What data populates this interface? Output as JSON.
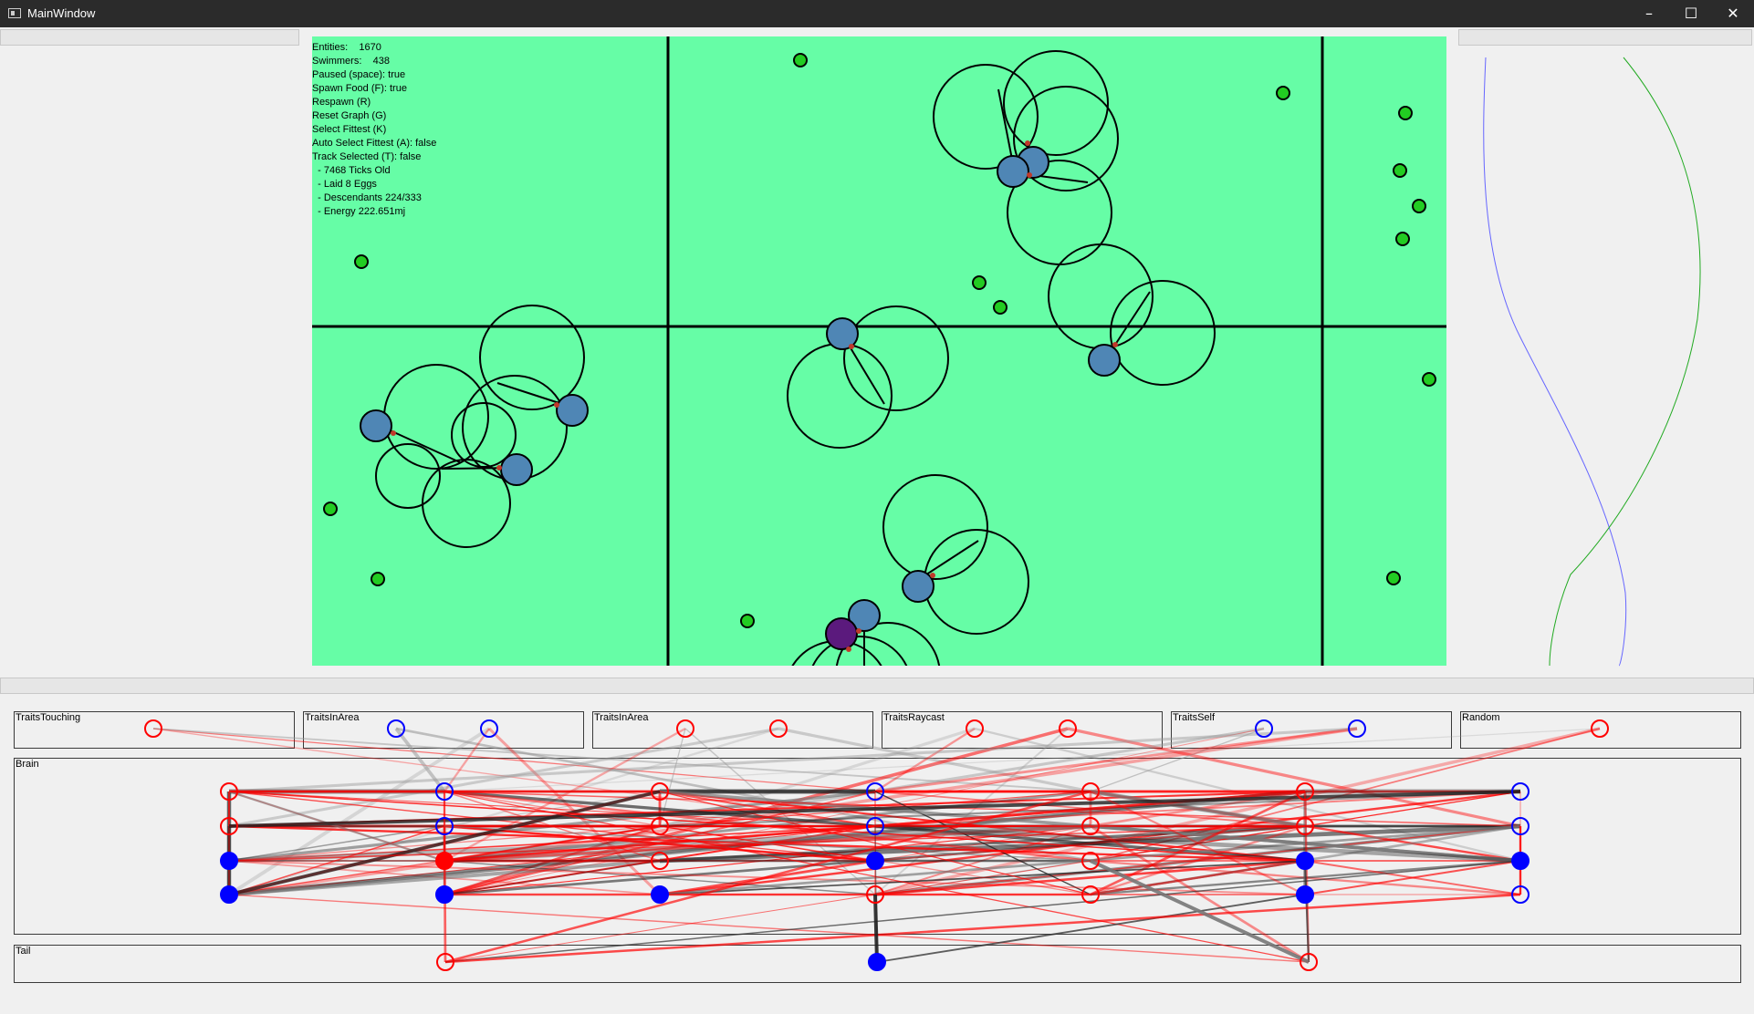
{
  "window": {
    "title": "MainWindow",
    "minimize_glyph": "–",
    "maximize_glyph": "☐",
    "close_glyph": "✕"
  },
  "hud": {
    "entities": "Entities:    1670",
    "swimmers": "Swimmers:    438",
    "paused": "Paused (space): true",
    "spawn_food": "Spawn Food (F): true",
    "respawn": "Respawn (R)",
    "reset_graph": "Reset Graph (G)",
    "select_fittest": "Select Fittest (K)",
    "auto_select": "Auto Select Fittest (A): false",
    "track_selected": "Track Selected (T): false",
    "ticks": "  - 7468 Ticks Old",
    "eggs": "  - Laid 8 Eggs",
    "descendants": "  - Descendants 224/333",
    "energy": "  - Energy 222.651mj"
  },
  "sim_colors": {
    "background": "#66fda6",
    "food": "#22cc22",
    "swimmer": "#4f86b5",
    "selected": "#5b1a7d"
  },
  "inputs": [
    {
      "label": "TraitsTouching",
      "nodes": [
        "red"
      ]
    },
    {
      "label": "TraitsInArea",
      "nodes": [
        "blue",
        "blue"
      ]
    },
    {
      "label": "TraitsInArea",
      "nodes": [
        "red",
        "red"
      ]
    },
    {
      "label": "TraitsRaycast",
      "nodes": [
        "red",
        "red"
      ]
    },
    {
      "label": "TraitsSelf",
      "nodes": [
        "blue",
        "blue"
      ]
    },
    {
      "label": "Random",
      "nodes": [
        "red"
      ]
    }
  ],
  "brain": {
    "label": "Brain",
    "columns": [
      [
        "red-hollow",
        "red-hollow",
        "blue-fill",
        "blue-fill"
      ],
      [
        "blue-hollow",
        "blue-hollow",
        "red-fill",
        "blue-fill"
      ],
      [
        "red-hollow",
        "red-hollow",
        "red-hollow",
        "blue-fill"
      ],
      [
        "blue-hollow",
        "blue-hollow",
        "blue-fill",
        "red-hollow"
      ],
      [
        "red-hollow",
        "red-hollow",
        "red-hollow",
        "red-hollow"
      ],
      [
        "red-hollow",
        "red-hollow",
        "blue-fill",
        "blue-fill"
      ],
      [
        "blue-hollow",
        "blue-hollow",
        "blue-fill",
        "blue-hollow"
      ]
    ]
  },
  "tail": {
    "label": "Tail",
    "nodes": [
      "red-hollow",
      "blue-fill",
      "red-hollow"
    ]
  },
  "colors": {
    "red": "#ff0000",
    "blue": "#0000ff",
    "titlebar": "#2b2b2b"
  }
}
